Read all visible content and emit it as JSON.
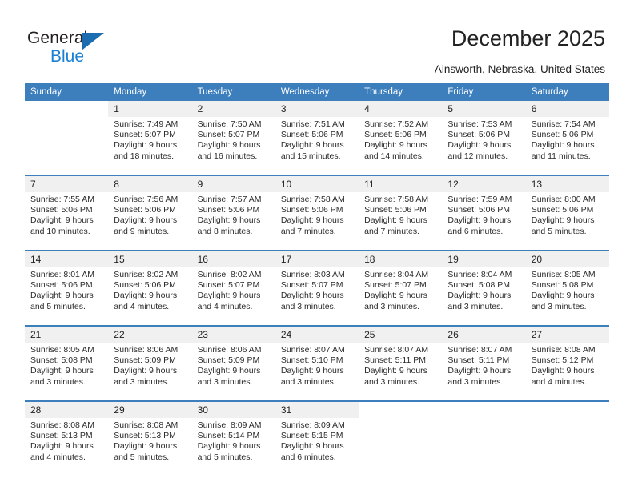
{
  "brand": {
    "name_top": "General",
    "name_bottom": "Blue",
    "accent_color": "#1b7fd4",
    "triangle_color": "#1b6cb0"
  },
  "header": {
    "title": "December 2025",
    "subtitle": "Ainsworth, Nebraska, United States",
    "header_bg": "#3d7ebd",
    "daynum_bg": "#f0f0f0"
  },
  "weekdays": [
    "Sunday",
    "Monday",
    "Tuesday",
    "Wednesday",
    "Thursday",
    "Friday",
    "Saturday"
  ],
  "weeks": [
    {
      "days": [
        {
          "num": "",
          "sunrise": "",
          "sunset": "",
          "daylight1": "",
          "daylight2": ""
        },
        {
          "num": "1",
          "sunrise": "Sunrise: 7:49 AM",
          "sunset": "Sunset: 5:07 PM",
          "daylight1": "Daylight: 9 hours",
          "daylight2": "and 18 minutes."
        },
        {
          "num": "2",
          "sunrise": "Sunrise: 7:50 AM",
          "sunset": "Sunset: 5:07 PM",
          "daylight1": "Daylight: 9 hours",
          "daylight2": "and 16 minutes."
        },
        {
          "num": "3",
          "sunrise": "Sunrise: 7:51 AM",
          "sunset": "Sunset: 5:06 PM",
          "daylight1": "Daylight: 9 hours",
          "daylight2": "and 15 minutes."
        },
        {
          "num": "4",
          "sunrise": "Sunrise: 7:52 AM",
          "sunset": "Sunset: 5:06 PM",
          "daylight1": "Daylight: 9 hours",
          "daylight2": "and 14 minutes."
        },
        {
          "num": "5",
          "sunrise": "Sunrise: 7:53 AM",
          "sunset": "Sunset: 5:06 PM",
          "daylight1": "Daylight: 9 hours",
          "daylight2": "and 12 minutes."
        },
        {
          "num": "6",
          "sunrise": "Sunrise: 7:54 AM",
          "sunset": "Sunset: 5:06 PM",
          "daylight1": "Daylight: 9 hours",
          "daylight2": "and 11 minutes."
        }
      ]
    },
    {
      "days": [
        {
          "num": "7",
          "sunrise": "Sunrise: 7:55 AM",
          "sunset": "Sunset: 5:06 PM",
          "daylight1": "Daylight: 9 hours",
          "daylight2": "and 10 minutes."
        },
        {
          "num": "8",
          "sunrise": "Sunrise: 7:56 AM",
          "sunset": "Sunset: 5:06 PM",
          "daylight1": "Daylight: 9 hours",
          "daylight2": "and 9 minutes."
        },
        {
          "num": "9",
          "sunrise": "Sunrise: 7:57 AM",
          "sunset": "Sunset: 5:06 PM",
          "daylight1": "Daylight: 9 hours",
          "daylight2": "and 8 minutes."
        },
        {
          "num": "10",
          "sunrise": "Sunrise: 7:58 AM",
          "sunset": "Sunset: 5:06 PM",
          "daylight1": "Daylight: 9 hours",
          "daylight2": "and 7 minutes."
        },
        {
          "num": "11",
          "sunrise": "Sunrise: 7:58 AM",
          "sunset": "Sunset: 5:06 PM",
          "daylight1": "Daylight: 9 hours",
          "daylight2": "and 7 minutes."
        },
        {
          "num": "12",
          "sunrise": "Sunrise: 7:59 AM",
          "sunset": "Sunset: 5:06 PM",
          "daylight1": "Daylight: 9 hours",
          "daylight2": "and 6 minutes."
        },
        {
          "num": "13",
          "sunrise": "Sunrise: 8:00 AM",
          "sunset": "Sunset: 5:06 PM",
          "daylight1": "Daylight: 9 hours",
          "daylight2": "and 5 minutes."
        }
      ]
    },
    {
      "days": [
        {
          "num": "14",
          "sunrise": "Sunrise: 8:01 AM",
          "sunset": "Sunset: 5:06 PM",
          "daylight1": "Daylight: 9 hours",
          "daylight2": "and 5 minutes."
        },
        {
          "num": "15",
          "sunrise": "Sunrise: 8:02 AM",
          "sunset": "Sunset: 5:06 PM",
          "daylight1": "Daylight: 9 hours",
          "daylight2": "and 4 minutes."
        },
        {
          "num": "16",
          "sunrise": "Sunrise: 8:02 AM",
          "sunset": "Sunset: 5:07 PM",
          "daylight1": "Daylight: 9 hours",
          "daylight2": "and 4 minutes."
        },
        {
          "num": "17",
          "sunrise": "Sunrise: 8:03 AM",
          "sunset": "Sunset: 5:07 PM",
          "daylight1": "Daylight: 9 hours",
          "daylight2": "and 3 minutes."
        },
        {
          "num": "18",
          "sunrise": "Sunrise: 8:04 AM",
          "sunset": "Sunset: 5:07 PM",
          "daylight1": "Daylight: 9 hours",
          "daylight2": "and 3 minutes."
        },
        {
          "num": "19",
          "sunrise": "Sunrise: 8:04 AM",
          "sunset": "Sunset: 5:08 PM",
          "daylight1": "Daylight: 9 hours",
          "daylight2": "and 3 minutes."
        },
        {
          "num": "20",
          "sunrise": "Sunrise: 8:05 AM",
          "sunset": "Sunset: 5:08 PM",
          "daylight1": "Daylight: 9 hours",
          "daylight2": "and 3 minutes."
        }
      ]
    },
    {
      "days": [
        {
          "num": "21",
          "sunrise": "Sunrise: 8:05 AM",
          "sunset": "Sunset: 5:08 PM",
          "daylight1": "Daylight: 9 hours",
          "daylight2": "and 3 minutes."
        },
        {
          "num": "22",
          "sunrise": "Sunrise: 8:06 AM",
          "sunset": "Sunset: 5:09 PM",
          "daylight1": "Daylight: 9 hours",
          "daylight2": "and 3 minutes."
        },
        {
          "num": "23",
          "sunrise": "Sunrise: 8:06 AM",
          "sunset": "Sunset: 5:09 PM",
          "daylight1": "Daylight: 9 hours",
          "daylight2": "and 3 minutes."
        },
        {
          "num": "24",
          "sunrise": "Sunrise: 8:07 AM",
          "sunset": "Sunset: 5:10 PM",
          "daylight1": "Daylight: 9 hours",
          "daylight2": "and 3 minutes."
        },
        {
          "num": "25",
          "sunrise": "Sunrise: 8:07 AM",
          "sunset": "Sunset: 5:11 PM",
          "daylight1": "Daylight: 9 hours",
          "daylight2": "and 3 minutes."
        },
        {
          "num": "26",
          "sunrise": "Sunrise: 8:07 AM",
          "sunset": "Sunset: 5:11 PM",
          "daylight1": "Daylight: 9 hours",
          "daylight2": "and 3 minutes."
        },
        {
          "num": "27",
          "sunrise": "Sunrise: 8:08 AM",
          "sunset": "Sunset: 5:12 PM",
          "daylight1": "Daylight: 9 hours",
          "daylight2": "and 4 minutes."
        }
      ]
    },
    {
      "days": [
        {
          "num": "28",
          "sunrise": "Sunrise: 8:08 AM",
          "sunset": "Sunset: 5:13 PM",
          "daylight1": "Daylight: 9 hours",
          "daylight2": "and 4 minutes."
        },
        {
          "num": "29",
          "sunrise": "Sunrise: 8:08 AM",
          "sunset": "Sunset: 5:13 PM",
          "daylight1": "Daylight: 9 hours",
          "daylight2": "and 5 minutes."
        },
        {
          "num": "30",
          "sunrise": "Sunrise: 8:09 AM",
          "sunset": "Sunset: 5:14 PM",
          "daylight1": "Daylight: 9 hours",
          "daylight2": "and 5 minutes."
        },
        {
          "num": "31",
          "sunrise": "Sunrise: 8:09 AM",
          "sunset": "Sunset: 5:15 PM",
          "daylight1": "Daylight: 9 hours",
          "daylight2": "and 6 minutes."
        },
        {
          "num": "",
          "sunrise": "",
          "sunset": "",
          "daylight1": "",
          "daylight2": ""
        },
        {
          "num": "",
          "sunrise": "",
          "sunset": "",
          "daylight1": "",
          "daylight2": ""
        },
        {
          "num": "",
          "sunrise": "",
          "sunset": "",
          "daylight1": "",
          "daylight2": ""
        }
      ]
    }
  ]
}
